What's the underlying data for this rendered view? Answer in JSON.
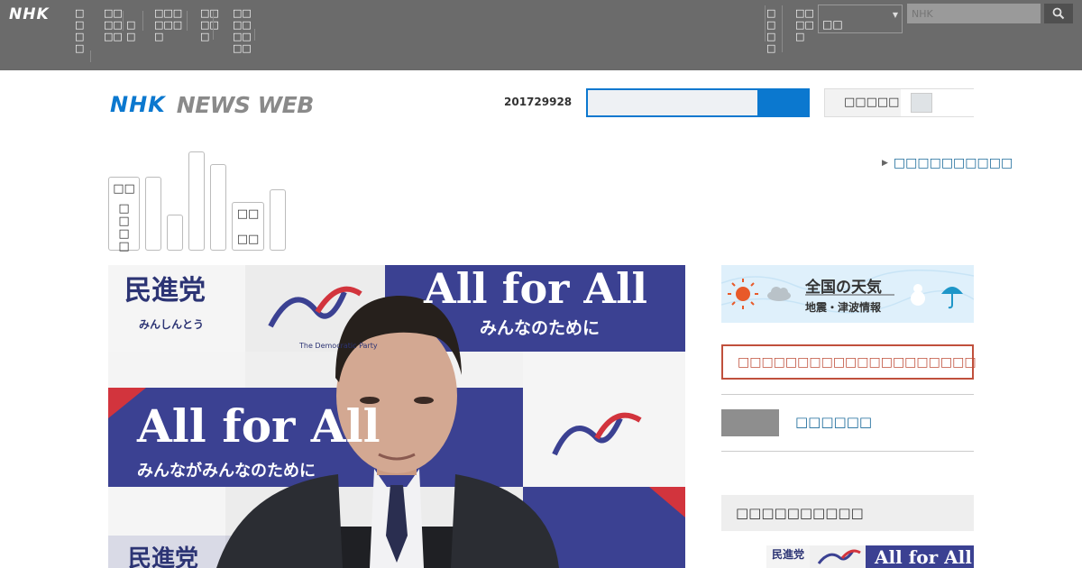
{
  "global": {
    "logo": "NHK",
    "nav_left": [
      "□□□□",
      "□□□□□□",
      "□□",
      "□□□□□□□",
      "□□□□□",
      "□□□□□□□□"
    ],
    "nav_right": [
      "□□□□",
      "□□□□□"
    ],
    "select_value": "□□",
    "search_placeholder": "NHK"
  },
  "header": {
    "logo_nhk": "NHK",
    "logo_news": "NEWS WEB",
    "date": "201729928",
    "toggle_label": "□□□□□"
  },
  "categories": [
    {
      "lines": [
        "□□",
        "□□□□"
      ]
    },
    {
      "lines": []
    },
    {
      "lines": []
    },
    {
      "lines": []
    },
    {
      "lines": []
    },
    {
      "lines": [
        "□□",
        "□□"
      ]
    },
    {
      "lines": []
    }
  ],
  "more_link": "□□□□□□□□□□",
  "main_photo": {
    "text_party": "民進党",
    "text_party_reading": "みんしんとう",
    "slogan": "All for All",
    "slogan_sub": "みんながみんなのために",
    "slogan_sub_short": "みんなのために",
    "logo_caption": "The Democratic Party"
  },
  "weather": {
    "title": "全国の天気",
    "subtitle": "地震・津波情報"
  },
  "alert_text": "□□□□□□□□□□□□□□□□□□□□",
  "gray_link": "□□□□□□",
  "ranking_title": "□□□□□□□□□□",
  "rank_thumb": {
    "text_party": "民進党",
    "slogan": "All for All"
  },
  "colors": {
    "global_bar": "#6b6b6b",
    "brand_blue": "#0b78cf",
    "alert_red": "#c0503c",
    "link_blue": "#1a6a9a"
  }
}
